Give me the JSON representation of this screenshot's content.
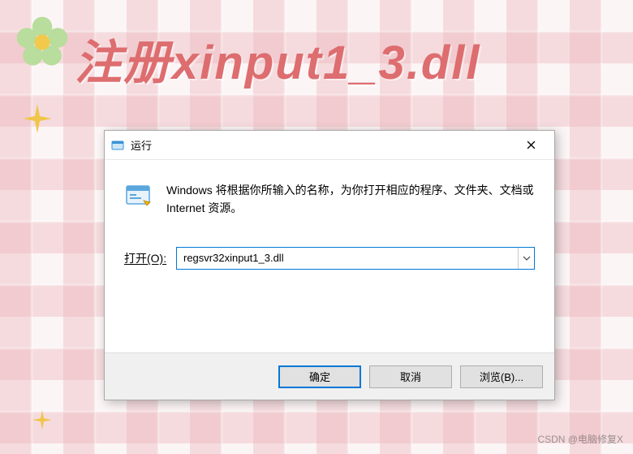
{
  "headline": "注册xinput1_3.dll",
  "dialog": {
    "title": "运行",
    "description": "Windows 将根据你所输入的名称，为你打开相应的程序、文件夹、文档或 Internet 资源。",
    "open_label": "打开(O):",
    "open_value": "regsvr32xinput1_3.dll",
    "buttons": {
      "ok": "确定",
      "cancel": "取消",
      "browse": "浏览(B)..."
    }
  },
  "watermark": "CSDN @电脑修复X"
}
